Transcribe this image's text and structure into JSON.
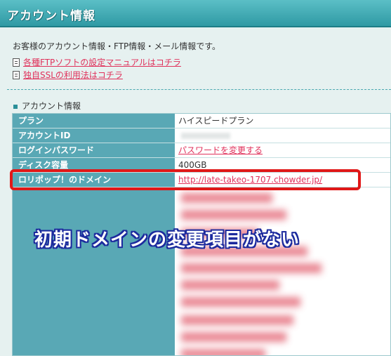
{
  "header": {
    "title": "アカウント情報"
  },
  "intro": "お客様のアカウント情報・FTP情報・メール情報です。",
  "links": [
    {
      "icon": "document-icon",
      "label": "各種FTPソフトの設定マニュアルはコチラ"
    },
    {
      "icon": "document-icon",
      "label": "独自SSLの利用法はコチラ"
    }
  ],
  "section": {
    "title": "アカウント情報"
  },
  "table": {
    "rows": [
      {
        "label": "プラン",
        "value": "ハイスピードプラン"
      },
      {
        "label": "アカウントID",
        "value": ""
      },
      {
        "label": "ログインパスワード",
        "value": "パスワードを変更する"
      },
      {
        "label": "ディスク容量",
        "value": "400GB"
      },
      {
        "label": "ロリポップ！のドメイン",
        "value": "http://late-takeo-1707.chowder.jp/"
      }
    ]
  },
  "callout": "初期ドメインの変更項目がない",
  "colors": {
    "header": "#3aa5ae",
    "label_cell": "#59a8b5",
    "link": "#e0315b",
    "highlight": "#e01818",
    "callout_outline": "#1c2b9e"
  }
}
